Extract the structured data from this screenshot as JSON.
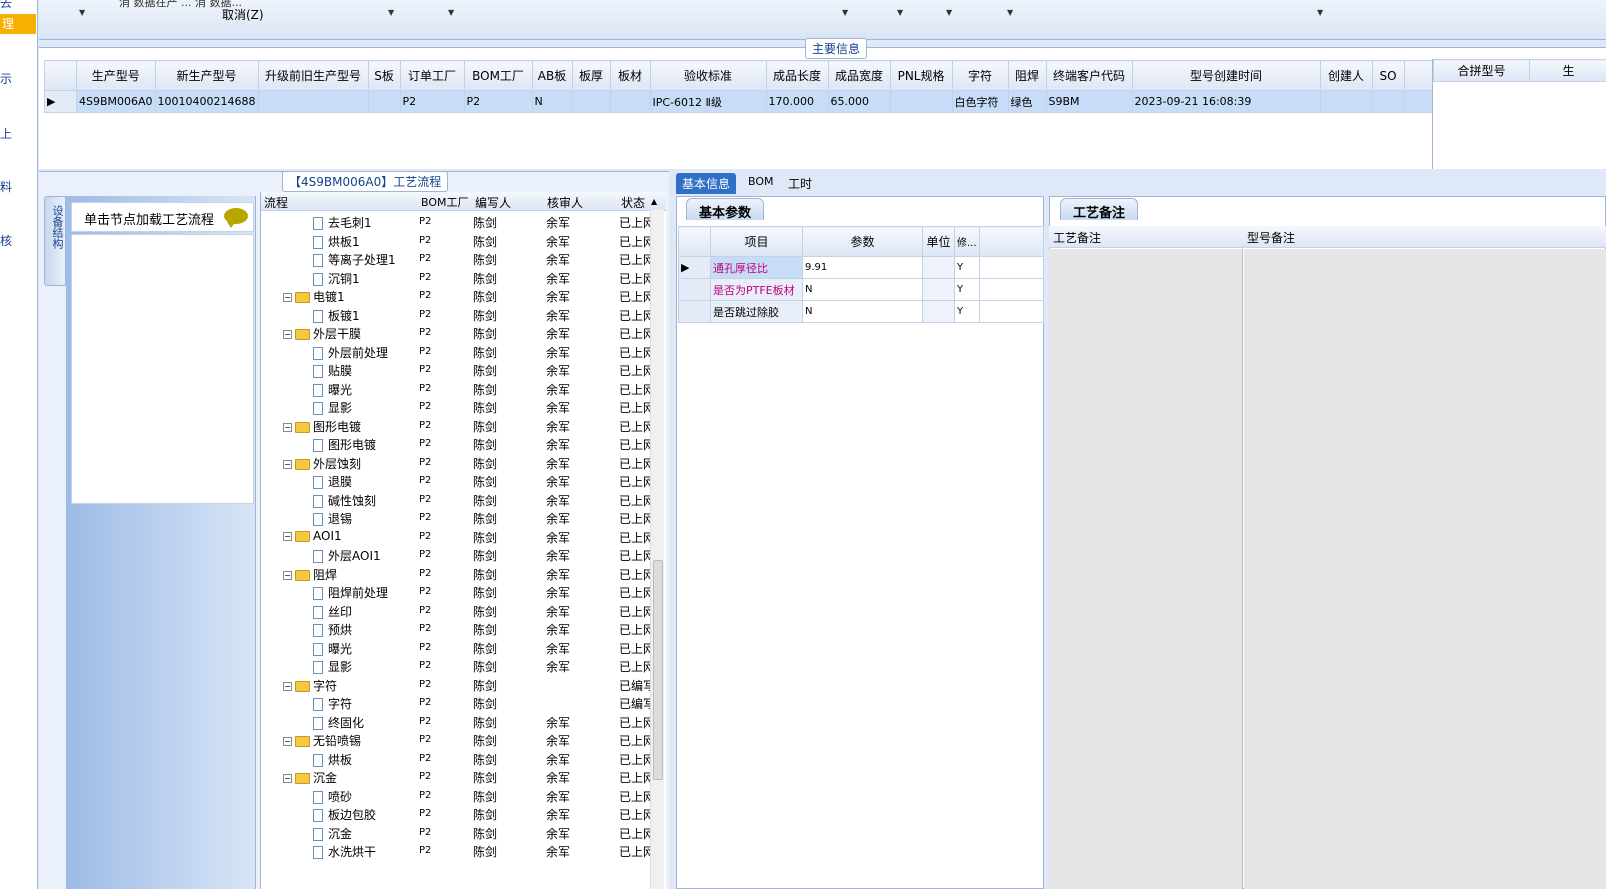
{
  "sidebar": {
    "items": [
      {
        "label": "去"
      },
      {
        "label": "理"
      },
      {
        "label": "示"
      },
      {
        "label": "上"
      },
      {
        "label": "料"
      },
      {
        "label": "核"
      }
    ]
  },
  "topbar": {
    "cancel_label": "取消(Z)",
    "truncated_text": "消 数据在产 ... 消 数据..."
  },
  "main_info": {
    "legend": "主要信息",
    "columns": [
      "生产型号",
      "新生产型号",
      "升级前旧生产型号",
      "S板",
      "订单工厂",
      "BOM工厂",
      "AB板",
      "板厚",
      "板材",
      "验收标准",
      "成品长度",
      "成品宽度",
      "PNL规格",
      "字符",
      "阻焊",
      "终端客户代码",
      "型号创建时间",
      "创建人",
      "SO"
    ],
    "row": [
      "4S9BM006A0",
      "10010400214688",
      "",
      "",
      "P2",
      "P2",
      "N",
      "",
      "",
      "IPC-6012 Ⅱ级",
      "170.000",
      "65.000",
      "",
      "白色字符",
      "绿色",
      "S9BM",
      "2023-09-21 16:08:39",
      "",
      ""
    ],
    "combine_columns": [
      "合拼型号",
      "生"
    ]
  },
  "flow": {
    "legend": "【4S9BM006A0】工艺流程",
    "side_tab": "设备结构",
    "load_hint": "单击节点加载工艺流程",
    "columns": [
      "流程",
      "BOM工厂",
      "编写人",
      "核审人",
      "状态"
    ],
    "rows": [
      {
        "name": "去毛刺1",
        "type": "doc",
        "level": 2,
        "factory": "P2",
        "writer": "陈剑",
        "reviewer": "余军",
        "status": "已上网"
      },
      {
        "name": "烘板1",
        "type": "doc",
        "level": 2,
        "factory": "P2",
        "writer": "陈剑",
        "reviewer": "余军",
        "status": "已上网"
      },
      {
        "name": "等离子处理1",
        "type": "doc",
        "level": 2,
        "factory": "P2",
        "writer": "陈剑",
        "reviewer": "余军",
        "status": "已上网"
      },
      {
        "name": "沉铜1",
        "type": "doc",
        "level": 2,
        "factory": "P2",
        "writer": "陈剑",
        "reviewer": "余军",
        "status": "已上网"
      },
      {
        "name": "电镀1",
        "type": "folder",
        "level": 1,
        "factory": "P2",
        "writer": "陈剑",
        "reviewer": "余军",
        "status": "已上网"
      },
      {
        "name": "板镀1",
        "type": "doc",
        "level": 2,
        "factory": "P2",
        "writer": "陈剑",
        "reviewer": "余军",
        "status": "已上网"
      },
      {
        "name": "外层干膜",
        "type": "folder",
        "level": 1,
        "factory": "P2",
        "writer": "陈剑",
        "reviewer": "余军",
        "status": "已上网"
      },
      {
        "name": "外层前处理",
        "type": "doc",
        "level": 2,
        "factory": "P2",
        "writer": "陈剑",
        "reviewer": "余军",
        "status": "已上网"
      },
      {
        "name": "贴膜",
        "type": "doc",
        "level": 2,
        "factory": "P2",
        "writer": "陈剑",
        "reviewer": "余军",
        "status": "已上网"
      },
      {
        "name": "曝光",
        "type": "doc",
        "level": 2,
        "factory": "P2",
        "writer": "陈剑",
        "reviewer": "余军",
        "status": "已上网"
      },
      {
        "name": "显影",
        "type": "doc",
        "level": 2,
        "factory": "P2",
        "writer": "陈剑",
        "reviewer": "余军",
        "status": "已上网"
      },
      {
        "name": "图形电镀",
        "type": "folder",
        "level": 1,
        "factory": "P2",
        "writer": "陈剑",
        "reviewer": "余军",
        "status": "已上网"
      },
      {
        "name": "图形电镀",
        "type": "doc",
        "level": 2,
        "factory": "P2",
        "writer": "陈剑",
        "reviewer": "余军",
        "status": "已上网"
      },
      {
        "name": "外层蚀刻",
        "type": "folder",
        "level": 1,
        "factory": "P2",
        "writer": "陈剑",
        "reviewer": "余军",
        "status": "已上网"
      },
      {
        "name": "退膜",
        "type": "doc",
        "level": 2,
        "factory": "P2",
        "writer": "陈剑",
        "reviewer": "余军",
        "status": "已上网"
      },
      {
        "name": "碱性蚀刻",
        "type": "doc",
        "level": 2,
        "factory": "P2",
        "writer": "陈剑",
        "reviewer": "余军",
        "status": "已上网"
      },
      {
        "name": "退锡",
        "type": "doc",
        "level": 2,
        "factory": "P2",
        "writer": "陈剑",
        "reviewer": "余军",
        "status": "已上网"
      },
      {
        "name": "AOI1",
        "type": "folder",
        "level": 1,
        "factory": "P2",
        "writer": "陈剑",
        "reviewer": "余军",
        "status": "已上网"
      },
      {
        "name": "外层AOI1",
        "type": "doc",
        "level": 2,
        "factory": "P2",
        "writer": "陈剑",
        "reviewer": "余军",
        "status": "已上网"
      },
      {
        "name": "阻焊",
        "type": "folder",
        "level": 1,
        "factory": "P2",
        "writer": "陈剑",
        "reviewer": "余军",
        "status": "已上网"
      },
      {
        "name": "阻焊前处理",
        "type": "doc",
        "level": 2,
        "factory": "P2",
        "writer": "陈剑",
        "reviewer": "余军",
        "status": "已上网"
      },
      {
        "name": "丝印",
        "type": "doc",
        "level": 2,
        "factory": "P2",
        "writer": "陈剑",
        "reviewer": "余军",
        "status": "已上网"
      },
      {
        "name": "预烘",
        "type": "doc",
        "level": 2,
        "factory": "P2",
        "writer": "陈剑",
        "reviewer": "余军",
        "status": "已上网"
      },
      {
        "name": "曝光",
        "type": "doc",
        "level": 2,
        "factory": "P2",
        "writer": "陈剑",
        "reviewer": "余军",
        "status": "已上网"
      },
      {
        "name": "显影",
        "type": "doc",
        "level": 2,
        "factory": "P2",
        "writer": "陈剑",
        "reviewer": "余军",
        "status": "已上网"
      },
      {
        "name": "字符",
        "type": "folder",
        "level": 1,
        "factory": "P2",
        "writer": "陈剑",
        "reviewer": "",
        "status": "已编写"
      },
      {
        "name": "字符",
        "type": "doc",
        "level": 2,
        "factory": "P2",
        "writer": "陈剑",
        "reviewer": "",
        "status": "已编写"
      },
      {
        "name": "终固化",
        "type": "doc",
        "level": 2,
        "factory": "P2",
        "writer": "陈剑",
        "reviewer": "余军",
        "status": "已上网"
      },
      {
        "name": "无铅喷锡",
        "type": "folder",
        "level": 1,
        "factory": "P2",
        "writer": "陈剑",
        "reviewer": "余军",
        "status": "已上网"
      },
      {
        "name": "烘板",
        "type": "doc",
        "level": 2,
        "factory": "P2",
        "writer": "陈剑",
        "reviewer": "余军",
        "status": "已上网"
      },
      {
        "name": "沉金",
        "type": "folder",
        "level": 1,
        "factory": "P2",
        "writer": "陈剑",
        "reviewer": "余军",
        "status": "已上网"
      },
      {
        "name": "喷砂",
        "type": "doc",
        "level": 2,
        "factory": "P2",
        "writer": "陈剑",
        "reviewer": "余军",
        "status": "已上网"
      },
      {
        "name": "板边包胶",
        "type": "doc",
        "level": 2,
        "factory": "P2",
        "writer": "陈剑",
        "reviewer": "余军",
        "status": "已上网"
      },
      {
        "name": "沉金",
        "type": "doc",
        "level": 2,
        "factory": "P2",
        "writer": "陈剑",
        "reviewer": "余军",
        "status": "已上网"
      },
      {
        "name": "水洗烘干",
        "type": "doc",
        "level": 2,
        "factory": "P2",
        "writer": "陈剑",
        "reviewer": "余军",
        "status": "已上网"
      }
    ]
  },
  "tabs": [
    "基本信息",
    "BOM",
    "工时"
  ],
  "basic": {
    "subtab": "基本参数",
    "columns": [
      "项目",
      "参数",
      "单位",
      "修..."
    ],
    "rows": [
      {
        "item": "通孔厚径比",
        "value": "9.91",
        "unit": "",
        "mod": "Y",
        "highlight": true
      },
      {
        "item": "是否为PTFE板材",
        "value": "N",
        "unit": "",
        "mod": "Y",
        "highlight": true
      },
      {
        "item": "是否跳过除胶",
        "value": "N",
        "unit": "",
        "mod": "Y",
        "highlight": false
      }
    ]
  },
  "notes": {
    "subtab": "工艺备注",
    "col1": "工艺备注",
    "col2": "型号备注"
  },
  "colors": {
    "accent": "#2f6fc6",
    "selected_row": "#c7dcf6",
    "highlight_text": "#c0007a",
    "sidebar_selected": "#f8b000"
  }
}
